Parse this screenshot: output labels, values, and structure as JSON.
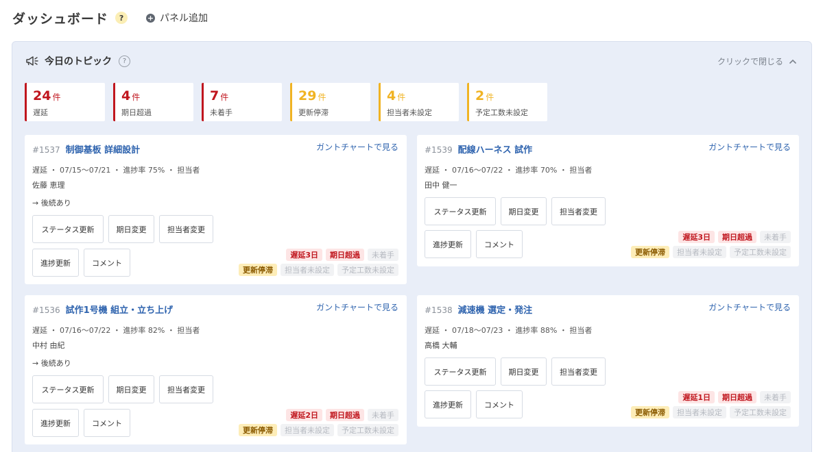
{
  "header": {
    "title": "ダッシュボード",
    "help": "?",
    "add_panel_label": "パネル追加"
  },
  "topics": {
    "title": "今日のトピック",
    "help": "?",
    "close_label": "クリックで閉じる"
  },
  "stats": [
    {
      "value": "24",
      "unit": "件",
      "label": "遅延",
      "color": "#c0161e"
    },
    {
      "value": "4",
      "unit": "件",
      "label": "期日超過",
      "color": "#c0161e"
    },
    {
      "value": "7",
      "unit": "件",
      "label": "未着手",
      "color": "#c0161e"
    },
    {
      "value": "29",
      "unit": "件",
      "label": "更新停滞",
      "color": "#f0b323"
    },
    {
      "value": "4",
      "unit": "件",
      "label": "担当者未設定",
      "color": "#f0b323"
    },
    {
      "value": "2",
      "unit": "件",
      "label": "予定工数未設定",
      "color": "#f0b323"
    }
  ],
  "card_actions": {
    "gantt_link": "ガントチャートで見る",
    "status_update": "ステータス更新",
    "date_change": "期日変更",
    "assignee_change": "担当者変更",
    "progress_update": "進捗更新",
    "comment": "コメント"
  },
  "cards": [
    {
      "id": "#1537",
      "title": "制御基板 詳細設計",
      "meta": "遅延 ・ 07/15〜07/21 ・ 進捗率 75% ・ 担当者",
      "assignee": "佐藤 恵理",
      "follow": "→ 後続あり",
      "badges_top": [
        "遅延3日",
        "期日超過",
        "未着手"
      ],
      "badges_bottom": [
        "更新停滞",
        "担当者未設定",
        "予定工数未設定"
      ]
    },
    {
      "id": "#1539",
      "title": "配線ハーネス 試作",
      "meta": "遅延 ・ 07/16〜07/22 ・ 進捗率 70% ・ 担当者",
      "assignee": "田中 健一",
      "follow": "",
      "badges_top": [
        "遅延3日",
        "期日超過",
        "未着手"
      ],
      "badges_bottom": [
        "更新停滞",
        "担当者未設定",
        "予定工数未設定"
      ]
    },
    {
      "id": "#1536",
      "title": "試作1号機 組立・立ち上げ",
      "meta": "遅延 ・ 07/16〜07/22 ・ 進捗率 82% ・ 担当者",
      "assignee": "中村 由紀",
      "follow": "→ 後続あり",
      "badges_top": [
        "遅延2日",
        "期日超過",
        "未着手"
      ],
      "badges_bottom": [
        "更新停滞",
        "担当者未設定",
        "予定工数未設定"
      ]
    },
    {
      "id": "#1538",
      "title": "減速機 選定・発注",
      "meta": "遅延 ・ 07/18〜07/23 ・ 進捗率 88% ・ 担当者",
      "assignee": "高橋 大輔",
      "follow": "",
      "badges_top": [
        "遅延1日",
        "期日超過",
        "未着手"
      ],
      "badges_bottom": [
        "更新停滞",
        "担当者未設定",
        "予定工数未設定"
      ]
    }
  ],
  "colors": {
    "red": "#c0161e",
    "amber": "#f0b323",
    "link": "#2e63ae",
    "panel_bg": "#e9eef8"
  }
}
